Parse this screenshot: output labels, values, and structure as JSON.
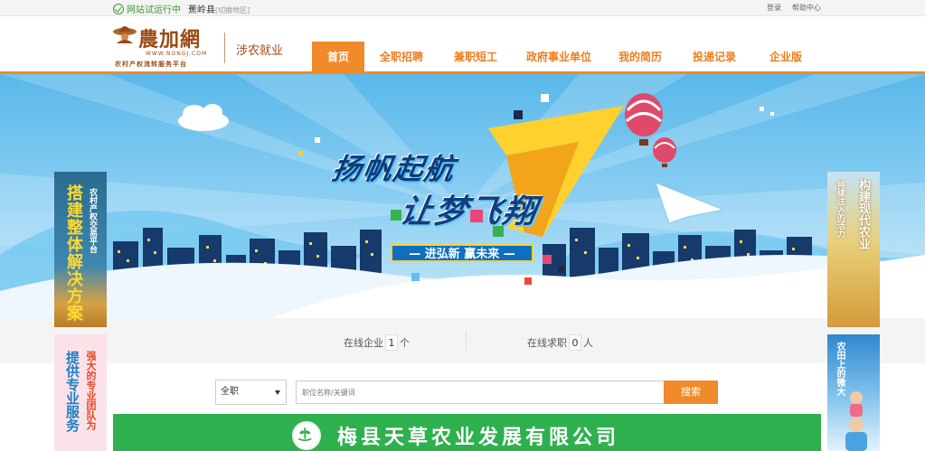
{
  "topbar": {
    "status": "网站试运行中",
    "region": "蕉岭县",
    "region_switch": "[切换地区]",
    "login": "登录",
    "help": "帮助中心"
  },
  "logo": {
    "name": "農加網",
    "url": "WWW.NONGJ.COM",
    "tagline": "农村产权流转服务平台",
    "subtitle": "涉农就业"
  },
  "nav": [
    {
      "label": "首页",
      "active": true
    },
    {
      "label": "全职招聘",
      "active": false
    },
    {
      "label": "兼职短工",
      "active": false
    },
    {
      "label": "政府事业单位",
      "active": false
    },
    {
      "label": "我的简历",
      "active": false
    },
    {
      "label": "投递记录",
      "active": false
    },
    {
      "label": "企业版",
      "active": false
    }
  ],
  "banner": {
    "line1": "扬帆起航",
    "line2": "让梦飞翔",
    "ribbon": "— 进弘新 赢未来 —"
  },
  "stats": {
    "companies_label": "在线企业",
    "companies_value": "1",
    "companies_unit": "个",
    "seekers_label": "在线求职",
    "seekers_value": "0",
    "seekers_unit": "人"
  },
  "search": {
    "category": "全职",
    "placeholder": "职位名称/关键词",
    "button": "搜索"
  },
  "company_banner": {
    "name": "梅县天草农业发展有限公司"
  },
  "ads": {
    "left_top_big": "搭建整体解决方案",
    "left_top_small": "农村产权交易平台",
    "left_bottom_big": "提供专业服务",
    "left_bottom_small": "强大的专业团队为",
    "right_top_big": "构建现代农业",
    "right_top_small": "持续注入的活力",
    "right_bottom_small": "农田上的微大"
  },
  "colors": {
    "accent": "#f08a2a",
    "brand_brown": "#9b4a16",
    "company_green": "#2fb04f",
    "status_green": "#3b9b2e"
  },
  "icons": [
    "check-circle-icon",
    "hat-logo-icon",
    "dropdown-caret-icon",
    "company-emblem-icon"
  ]
}
